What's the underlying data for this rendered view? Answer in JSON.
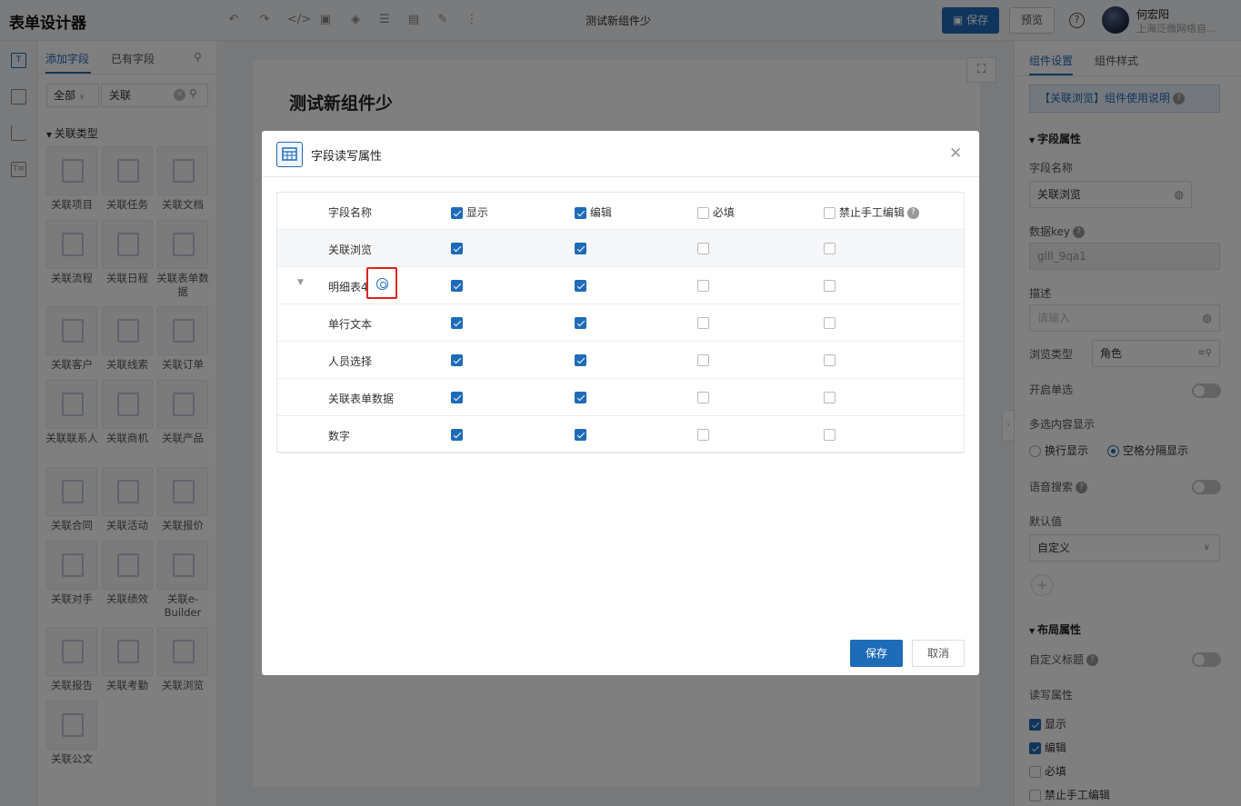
{
  "topbar": {
    "app_title": "表单设计器",
    "doc_title": "测试新组件少",
    "save_label": "保存",
    "preview_label": "预览",
    "user_name": "何宏阳",
    "user_org": "上海泛微网络自..."
  },
  "left": {
    "tab_add": "添加字段",
    "tab_existing": "已有字段",
    "filter_all": "全部",
    "search_value": "关联",
    "category": "关联类型",
    "items": [
      "关联项目",
      "关联任务",
      "关联文档",
      "关联流程",
      "关联日程",
      "关联表单数据",
      "关联客户",
      "关联线索",
      "关联订单",
      "关联联系人",
      "关联商机",
      "关联产品",
      "关联合同",
      "关联活动",
      "关联报价",
      "关联对手",
      "关联绩效",
      "关联e-Builder",
      "关联报告",
      "关联考勤",
      "关联浏览",
      "关联公文"
    ]
  },
  "canvas": {
    "paper_title": "测试新组件少"
  },
  "modal": {
    "title": "字段读写属性",
    "headers": {
      "name": "字段名称",
      "show": "显示",
      "edit": "编辑",
      "required": "必填",
      "no_manual": "禁止手工编辑"
    },
    "rows": [
      {
        "name": "关联浏览",
        "show": true,
        "edit": true,
        "required": false,
        "no_manual": false
      },
      {
        "name": "明细表4",
        "show": true,
        "edit": true,
        "required": false,
        "no_manual": false
      },
      {
        "name": "单行文本",
        "show": true,
        "edit": true,
        "required": false,
        "no_manual": false
      },
      {
        "name": "人员选择",
        "show": true,
        "edit": true,
        "required": false,
        "no_manual": false
      },
      {
        "name": "关联表单数据",
        "show": true,
        "edit": true,
        "required": false,
        "no_manual": false
      },
      {
        "name": "数字",
        "show": true,
        "edit": true,
        "required": false,
        "no_manual": false
      }
    ],
    "save_label": "保存",
    "cancel_label": "取消"
  },
  "right": {
    "tab_settings": "组件设置",
    "tab_style": "组件样式",
    "info_link": "【关联浏览】组件使用说明",
    "field_section": "字段属性",
    "field_name_label": "字段名称",
    "field_name_value": "关联浏览",
    "data_key_label": "数据key",
    "data_key_value": "glll_9qa1",
    "desc_label": "描述",
    "desc_placeholder": "请输入",
    "browse_type_label": "浏览类型",
    "browse_type_value": "角色",
    "single_select_label": "开启单选",
    "multi_display_label": "多选内容显示",
    "radio_wrap": "换行显示",
    "radio_space": "空格分隔显示",
    "voice_search_label": "语音搜索",
    "default_label": "默认值",
    "default_value": "自定义",
    "layout_section": "布局属性",
    "custom_title_label": "自定义标题",
    "rw_label": "读写属性",
    "rw_show": "显示",
    "rw_edit": "编辑",
    "rw_required": "必填",
    "rw_no_manual": "禁止手工编辑"
  }
}
